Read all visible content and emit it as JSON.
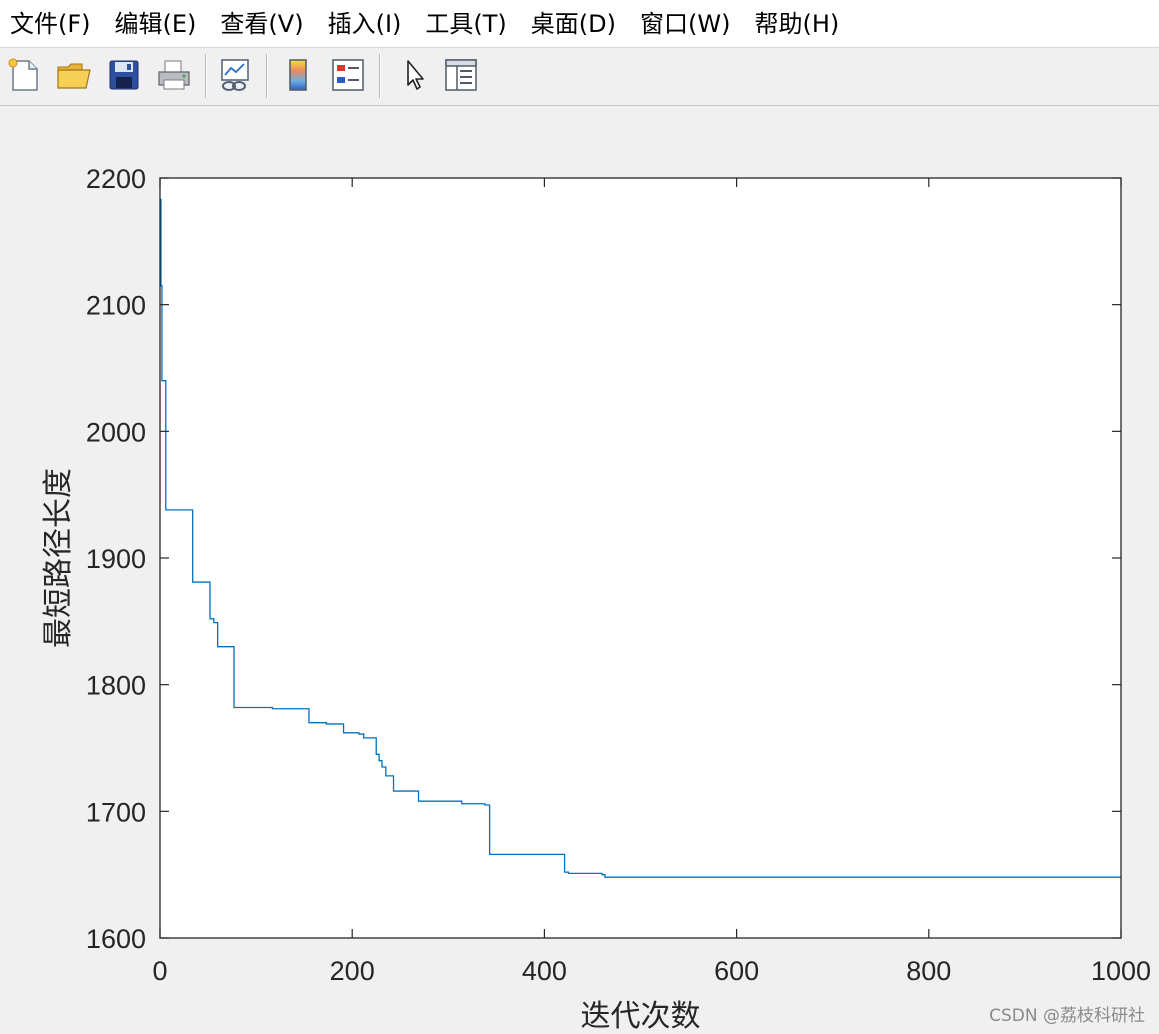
{
  "menu": {
    "items": [
      {
        "label": "文件(F)",
        "name": "menu-file"
      },
      {
        "label": "编辑(E)",
        "name": "menu-edit"
      },
      {
        "label": "查看(V)",
        "name": "menu-view"
      },
      {
        "label": "插入(I)",
        "name": "menu-insert"
      },
      {
        "label": "工具(T)",
        "name": "menu-tools"
      },
      {
        "label": "桌面(D)",
        "name": "menu-desktop"
      },
      {
        "label": "窗口(W)",
        "name": "menu-window"
      },
      {
        "label": "帮助(H)",
        "name": "menu-help"
      }
    ]
  },
  "toolbar": {
    "buttons": [
      {
        "name": "new-figure-button",
        "icon": "new-document-icon"
      },
      {
        "name": "open-file-button",
        "icon": "folder-open-icon"
      },
      {
        "name": "save-button",
        "icon": "floppy-disk-icon"
      },
      {
        "name": "print-button",
        "icon": "printer-icon"
      },
      {
        "name": "link-plot-button",
        "icon": "link-plot-icon"
      },
      {
        "name": "insert-colorbar-button",
        "icon": "colorbar-icon"
      },
      {
        "name": "insert-legend-button",
        "icon": "legend-icon"
      },
      {
        "name": "edit-plot-button",
        "icon": "cursor-arrow-icon"
      },
      {
        "name": "property-inspector-button",
        "icon": "property-panel-icon"
      }
    ]
  },
  "watermark": "CSDN @荔枝科研社",
  "chart_data": {
    "type": "line",
    "title": "",
    "xlabel": "迭代次数",
    "ylabel": "最短路径长度",
    "xlim": [
      0,
      1000
    ],
    "ylim": [
      1600,
      2200
    ],
    "xticks": [
      0,
      200,
      400,
      600,
      800,
      1000
    ],
    "yticks": [
      1600,
      1700,
      1800,
      1900,
      2000,
      2100,
      2200
    ],
    "grid": false,
    "line_color": "#0072bd",
    "series": [
      {
        "step": true,
        "x": [
          0,
          1,
          2,
          6,
          34,
          52,
          56,
          60,
          77,
          117,
          155,
          173,
          191,
          207,
          212,
          225,
          228,
          231,
          235,
          243,
          269,
          314,
          338,
          343,
          421,
          425,
          460,
          463,
          1000
        ],
        "y": [
          2183,
          2115,
          2040,
          1938,
          1881,
          1852,
          1849,
          1830,
          1782,
          1781,
          1770,
          1769,
          1762,
          1761,
          1758,
          1745,
          1740,
          1735,
          1728,
          1716,
          1708,
          1706,
          1705,
          1666,
          1652,
          1651,
          1650,
          1648,
          1648
        ]
      }
    ]
  }
}
